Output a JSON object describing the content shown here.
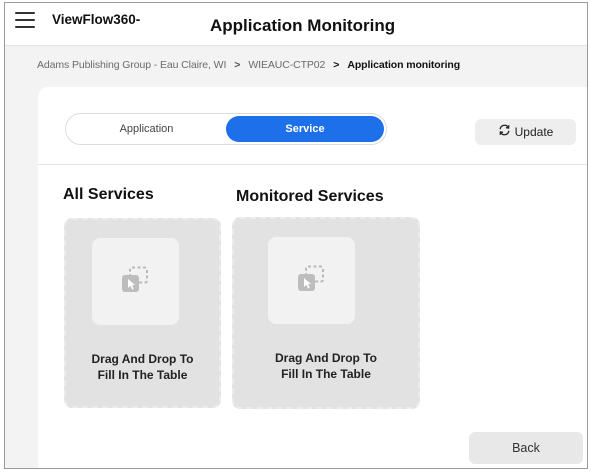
{
  "header": {
    "brand": "ViewFlow360-",
    "title": "Application Monitoring"
  },
  "breadcrumb": {
    "items": [
      "Adams Publishing Group - Eau Claire, WI",
      "WIEAUC-CTP02",
      "Application monitoring"
    ]
  },
  "toggle": {
    "options": [
      "Application",
      "Service"
    ],
    "selected": "Service"
  },
  "actions": {
    "update_label": "Update",
    "back_label": "Back"
  },
  "sections": {
    "all_title": "All Services",
    "monitored_title": "Monitored Services"
  },
  "dropzones": {
    "all": {
      "line1": "Drag And Drop To",
      "line2": "Fill In The Table"
    },
    "monitored": {
      "line1": "Drag And Drop To",
      "line2": "Fill In The Table"
    }
  },
  "icons": {
    "menu": "hamburger-menu-icon",
    "refresh": "refresh-icon",
    "drag": "drag-drop-icon"
  },
  "colors": {
    "accent": "#1e6fea",
    "dropzone_bg": "#e2e2e2"
  }
}
